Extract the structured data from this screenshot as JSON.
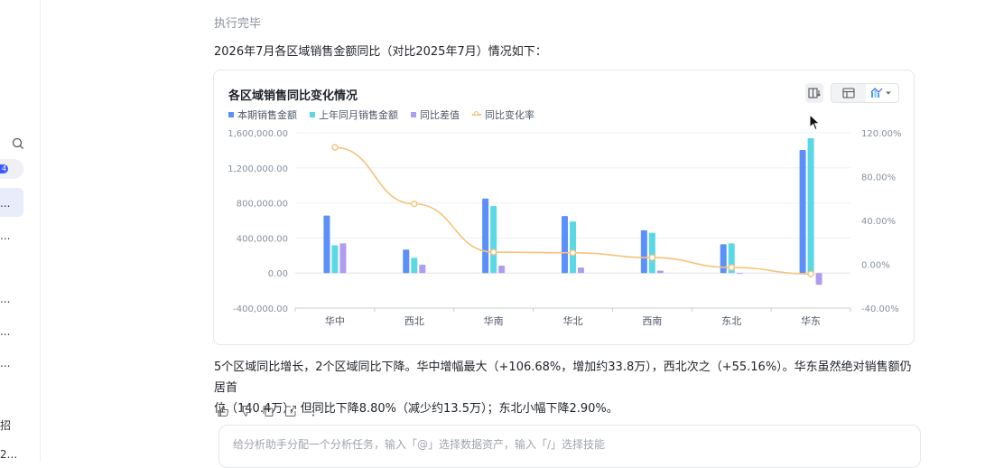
{
  "sidebar": {
    "badge": "4",
    "items": [
      "...",
      "...",
      "...",
      "...",
      "...",
      "招",
      "2..."
    ]
  },
  "status": "执行完毕",
  "intro": "2026年7月各区域销售金额同比（对比2025年7月）情况如下：",
  "card": {
    "title": "各区域销售同比变化情况",
    "toolbar_icons": [
      "switch-axis-icon",
      "table-view-icon",
      "chart-view-icon",
      "chevron-down-icon"
    ]
  },
  "chart_data": {
    "type": "bar",
    "categories": [
      "华中",
      "西北",
      "华南",
      "华北",
      "西南",
      "东北",
      "华东"
    ],
    "series": [
      {
        "name": "本期销售金额",
        "type": "bar",
        "axis": "left",
        "color": "#5b8ff9",
        "values": [
          655000,
          268000,
          850000,
          650000,
          488000,
          328000,
          1404000
        ]
      },
      {
        "name": "上年同月销售金额",
        "type": "bar",
        "axis": "left",
        "color": "#5ad8e6",
        "values": [
          317000,
          173000,
          765000,
          588000,
          460000,
          338000,
          1539000
        ]
      },
      {
        "name": "同比差值",
        "type": "bar",
        "axis": "left",
        "color": "#b09cf0",
        "values": [
          338000,
          95000,
          85000,
          62000,
          28000,
          -10000,
          -135000
        ]
      },
      {
        "name": "同比变化率",
        "type": "line",
        "axis": "right",
        "color": "#f8c27a",
        "values": [
          106.68,
          55.16,
          11.1,
          10.5,
          6.1,
          -2.9,
          -8.8
        ]
      }
    ],
    "y_left": {
      "ticks": [
        "1,600,000.00",
        "1,200,000.00",
        "800,000.00",
        "400,000.00",
        "0.00",
        "-400,000.00"
      ],
      "range": [
        -400000,
        1600000
      ]
    },
    "y_right": {
      "ticks": [
        "120.00%",
        "80.00%",
        "40.00%",
        "0.00%",
        "-40.00%"
      ],
      "range": [
        -40,
        120
      ]
    },
    "grid": true,
    "legend": "top-left"
  },
  "summary": {
    "line1": "5个区域同比增长，2个区域同比下降。华中增幅最大（+106.68%，增加约33.8万），西北次之（+55.16%）。华东虽然绝对销售额仍居首",
    "line2": "位（140.4万），但同比下降8.80%（减少约13.5万）；东北小幅下降2.90%。"
  },
  "actions": [
    "thumbs-up-icon",
    "thumbs-down-icon",
    "copy-icon",
    "share-icon",
    "more-icon"
  ],
  "composer": {
    "placeholder": "给分析助手分配一个分析任务，输入「@」选择数据资产，输入「/」选择技能"
  }
}
